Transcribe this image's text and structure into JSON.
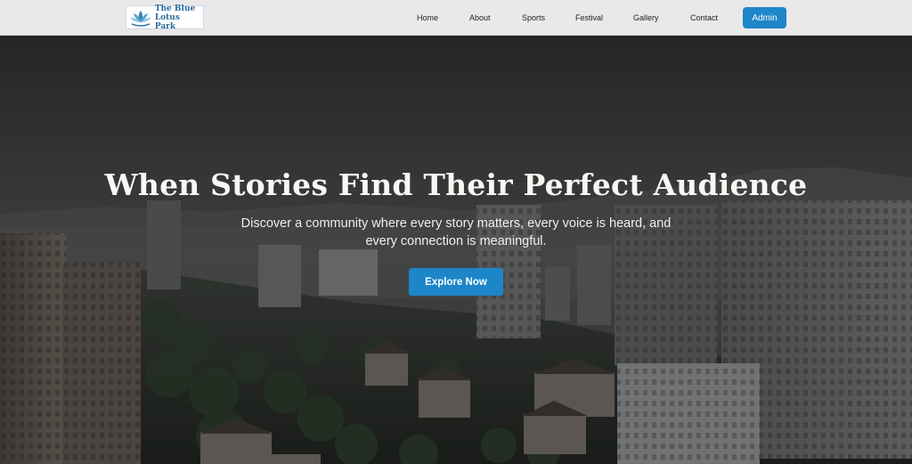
{
  "brand": {
    "line1": "The Blue",
    "line2": "Lotus Park",
    "logo_icon": "lotus-icon",
    "brand_color": "#2b6c9c"
  },
  "nav": {
    "items": [
      {
        "label": "Home"
      },
      {
        "label": "About"
      },
      {
        "label": "Sports"
      },
      {
        "label": "Festival"
      },
      {
        "label": "Gallery"
      },
      {
        "label": "Contact"
      }
    ],
    "admin_label": "Admin",
    "accent": "#1e86c9"
  },
  "hero": {
    "title": "When Stories Find Their Perfect Audience",
    "subtitle": "Discover a community where every story matters, every voice is heard, and every connection is meaningful.",
    "cta_label": "Explore Now",
    "cta_color": "#1d86c8"
  }
}
